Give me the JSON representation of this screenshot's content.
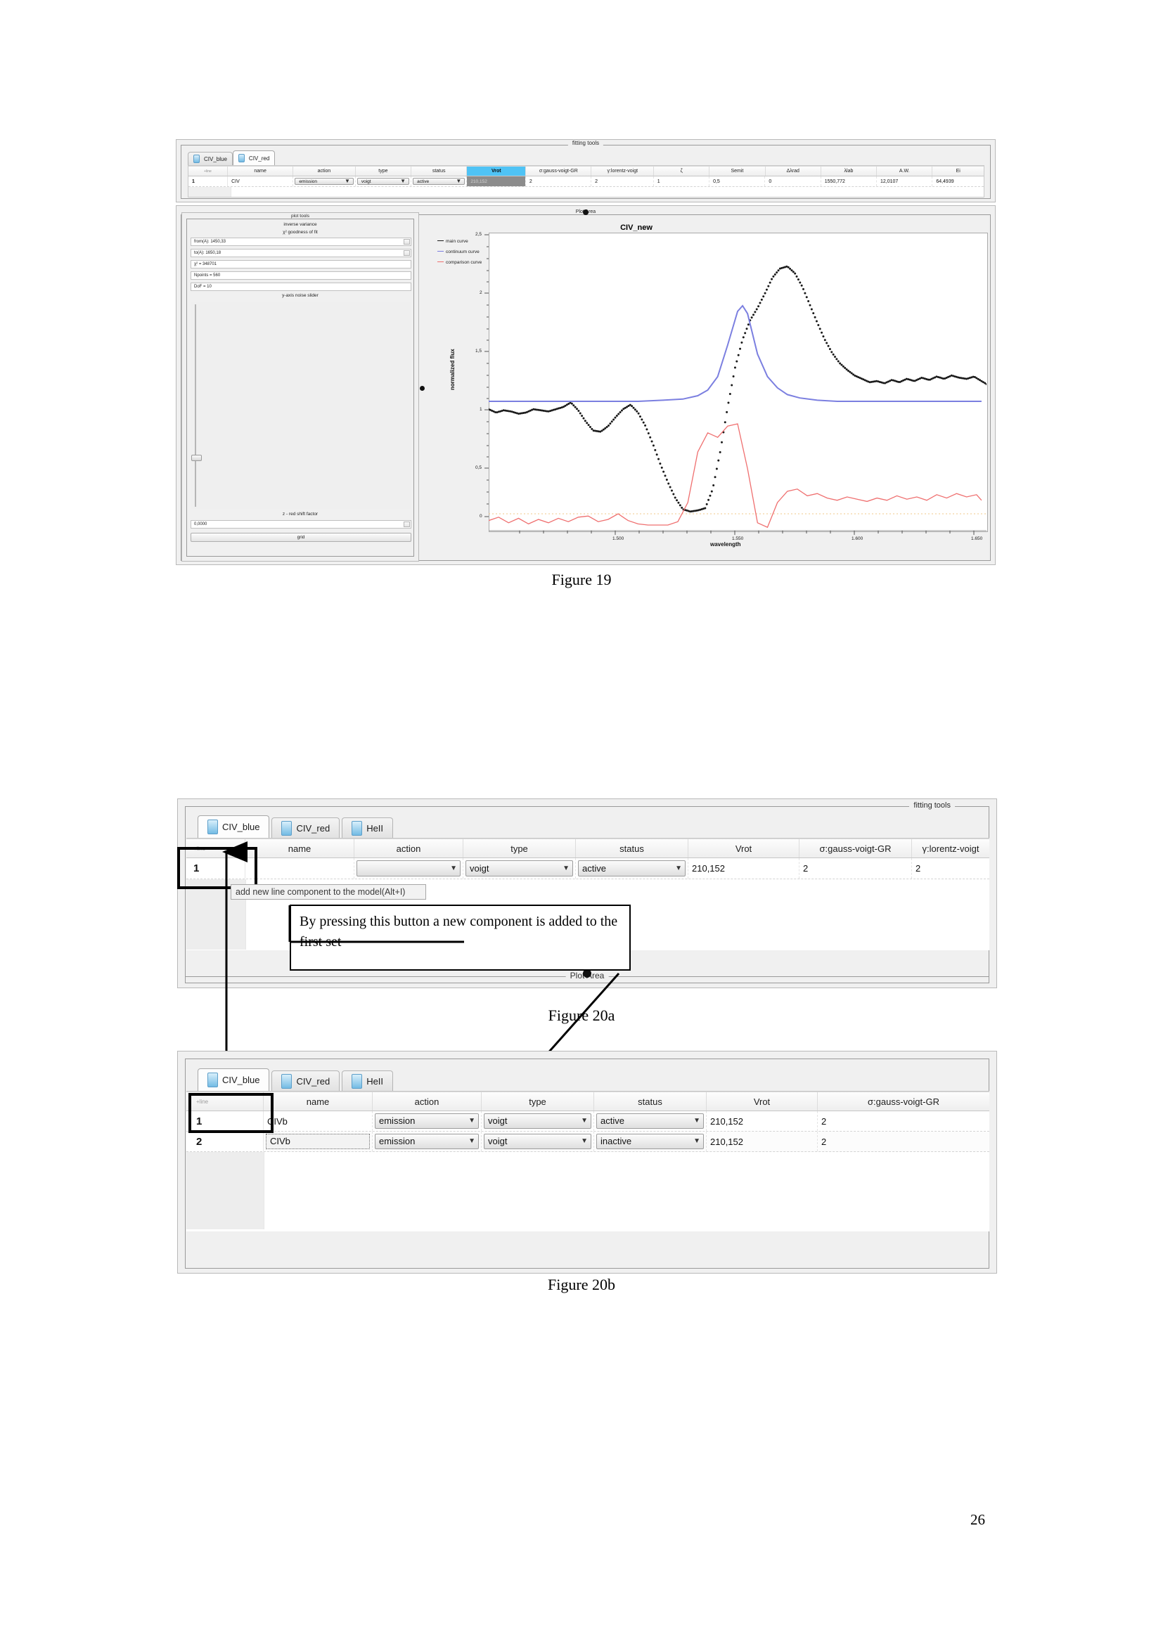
{
  "document": {
    "page_number": "26",
    "captions": {
      "fig19": "Figure 19",
      "fig20a": "Figure 20a",
      "fig20b": "Figure 20b"
    }
  },
  "figure19": {
    "window_title": "fitting tools",
    "plot_area_title": "Plot Area",
    "tabs": [
      {
        "label": "CIV_blue",
        "active": false
      },
      {
        "label": "CIV_red",
        "active": true
      }
    ],
    "table": {
      "headers": [
        "+line",
        "name",
        "action",
        "type",
        "status",
        "Vrot",
        "σ:gauss-voigt-GR",
        "γ:lorentz-voigt",
        "ζ",
        "Semit",
        "Δλrad",
        "λlab",
        "A.W.",
        "Ei"
      ],
      "selected_header": "Vrot",
      "rows": [
        {
          "index": "1",
          "name": "CIV",
          "action": "emission",
          "type": "voigt",
          "status": "active",
          "vrot": "210,152",
          "sigma": "2",
          "gamma": "2",
          "zeta": "1",
          "semit": "0,5",
          "dlrad": "0",
          "lambda_lab": "1550,772",
          "aw": "12,0107",
          "ei": "64,4939"
        }
      ]
    },
    "plot_tools": {
      "title": "plot tools",
      "subtitle1": "inverse variance",
      "subtitle2": "χ² goodness of fit",
      "from_field": "from(A): 1450,33",
      "to_field": "to(A): 1650,18",
      "chi2_field": "χ² = 348701",
      "npoints_field": "Npoints = 560",
      "dof_field": "DoF = 10",
      "noise_slider_label": "y-axis noise slider",
      "redshift_label": "z - red shift factor",
      "redshift_value": "0,0000",
      "grid_button": "grid"
    },
    "chart_data": {
      "type": "line",
      "title": "CIV_new",
      "xlabel": "wavelength",
      "ylabel": "normalized flux",
      "xlim": [
        1450,
        1650
      ],
      "ylim": [
        -0.15,
        2.5
      ],
      "xticks": [
        "1.500",
        "1.550",
        "1.600",
        "1.650"
      ],
      "xtick_values": [
        1500,
        1550,
        1600,
        1650
      ],
      "yticks": [
        "0",
        "0,5",
        "1",
        "1,5",
        "2",
        "2,5"
      ],
      "ytick_values": [
        0,
        0.5,
        1,
        1.5,
        2,
        2.5
      ],
      "grid": false,
      "legend_position": "left-outside",
      "series": [
        {
          "name": "main curve",
          "color": "#1a1a1a",
          "style": "dotted",
          "x": [
            1450,
            1453,
            1456,
            1459,
            1462,
            1465,
            1468,
            1471,
            1474,
            1477,
            1480,
            1483,
            1486,
            1489,
            1492,
            1495,
            1498,
            1501,
            1504,
            1507,
            1510,
            1513,
            1516,
            1519,
            1522,
            1525,
            1528,
            1531,
            1534,
            1537,
            1540,
            1543,
            1546,
            1549,
            1552,
            1555,
            1558,
            1561,
            1564,
            1567,
            1570,
            1573,
            1576,
            1579,
            1582,
            1585,
            1588,
            1591,
            1594,
            1597,
            1600,
            1603,
            1606,
            1609,
            1612,
            1615,
            1618,
            1621,
            1624,
            1627,
            1630,
            1633,
            1636,
            1639,
            1642,
            1645,
            1648
          ],
          "y": [
            0.93,
            0.9,
            0.92,
            0.91,
            0.89,
            0.9,
            0.93,
            0.92,
            0.91,
            0.93,
            0.95,
            0.99,
            0.92,
            0.82,
            0.74,
            0.73,
            0.78,
            0.86,
            0.93,
            0.97,
            0.9,
            0.78,
            0.62,
            0.44,
            0.28,
            0.14,
            0.04,
            0.02,
            0.03,
            0.05,
            0.22,
            0.55,
            0.95,
            1.3,
            1.55,
            1.72,
            1.83,
            1.96,
            2.1,
            2.18,
            2.2,
            2.14,
            2.02,
            1.86,
            1.7,
            1.55,
            1.43,
            1.34,
            1.28,
            1.23,
            1.2,
            1.17,
            1.18,
            1.16,
            1.19,
            1.17,
            1.2,
            1.18,
            1.21,
            1.19,
            1.22,
            1.2,
            1.23,
            1.21,
            1.2,
            1.22,
            1.18
          ]
        },
        {
          "name": "continuum curve",
          "color": "#7b7fe0",
          "style": "solid",
          "x": [
            1450,
            1470,
            1490,
            1510,
            1520,
            1528,
            1534,
            1538,
            1542,
            1546,
            1550,
            1552,
            1554,
            1556,
            1558,
            1562,
            1566,
            1570,
            1575,
            1582,
            1590,
            1600,
            1620,
            1648
          ],
          "y": [
            1.0,
            1.0,
            1.0,
            1.0,
            1.01,
            1.02,
            1.05,
            1.1,
            1.22,
            1.5,
            1.8,
            1.85,
            1.78,
            1.6,
            1.42,
            1.22,
            1.12,
            1.06,
            1.03,
            1.01,
            1.0,
            1.0,
            1.0,
            1.0
          ]
        },
        {
          "name": "comparison curve",
          "color": "#ef6f6f",
          "style": "solid",
          "x": [
            1450,
            1454,
            1458,
            1462,
            1466,
            1470,
            1474,
            1478,
            1482,
            1486,
            1490,
            1494,
            1498,
            1502,
            1506,
            1510,
            1514,
            1518,
            1522,
            1526,
            1530,
            1534,
            1538,
            1542,
            1546,
            1550,
            1554,
            1558,
            1562,
            1566,
            1570,
            1574,
            1578,
            1582,
            1586,
            1590,
            1594,
            1598,
            1602,
            1606,
            1610,
            1614,
            1618,
            1622,
            1626,
            1630,
            1634,
            1638,
            1642,
            1646,
            1648
          ],
          "y": [
            -0.06,
            -0.03,
            -0.08,
            -0.04,
            -0.09,
            -0.05,
            -0.08,
            -0.04,
            -0.07,
            -0.03,
            -0.02,
            -0.07,
            -0.05,
            0.0,
            -0.06,
            -0.09,
            -0.1,
            -0.1,
            -0.1,
            -0.07,
            0.1,
            0.55,
            0.72,
            0.68,
            0.78,
            0.8,
            0.4,
            -0.08,
            -0.12,
            0.1,
            0.2,
            0.22,
            0.16,
            0.18,
            0.14,
            0.12,
            0.15,
            0.13,
            0.11,
            0.14,
            0.12,
            0.16,
            0.13,
            0.15,
            0.12,
            0.17,
            0.14,
            0.18,
            0.15,
            0.17,
            0.12
          ]
        }
      ]
    }
  },
  "figure20a": {
    "window_title": "fitting tools",
    "plot_area_title": "Plot Area",
    "tabs": [
      {
        "label": "CIV_blue",
        "active": true
      },
      {
        "label": "CIV_red",
        "active": false
      },
      {
        "label": "HeII",
        "active": false
      }
    ],
    "table": {
      "headers": [
        "+line",
        "name",
        "action",
        "type",
        "status",
        "Vrot",
        "σ:gauss-voigt-GR",
        "γ:lorentz-voigt"
      ],
      "rows": [
        {
          "index": "1",
          "name": "",
          "action": "",
          "type": "voigt",
          "status": "active",
          "vrot": "210,152",
          "sigma": "2",
          "gamma": "2"
        }
      ]
    },
    "tooltip": "add new line component to the model(Alt+I)",
    "annotation": "By pressing this button a new component is added to the first set"
  },
  "figure20b": {
    "tabs": [
      {
        "label": "CIV_blue",
        "active": true
      },
      {
        "label": "CIV_red",
        "active": false
      },
      {
        "label": "HeII",
        "active": false
      }
    ],
    "table": {
      "headers": [
        "+line",
        "name",
        "action",
        "type",
        "status",
        "Vrot",
        "σ:gauss-voigt-GR"
      ],
      "rows": [
        {
          "index": "1",
          "name": "CIVb",
          "action": "emission",
          "type": "voigt",
          "status": "active",
          "vrot": "210,152",
          "sigma": "2"
        },
        {
          "index": "2",
          "name": "CIVb",
          "action": "emission",
          "type": "voigt",
          "status": "inactive",
          "vrot": "210,152",
          "sigma": "2"
        }
      ]
    }
  },
  "colors": {
    "selected_header": "#4fc3f5",
    "main_curve": "#1a1a1a",
    "continuum_curve": "#7b7fe0",
    "comparison_curve": "#ef6f6f"
  }
}
